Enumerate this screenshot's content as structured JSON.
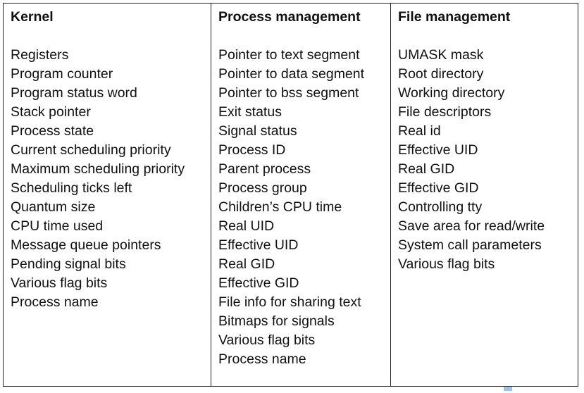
{
  "columns": [
    {
      "header": "Kernel",
      "items": [
        "Registers",
        "Program counter",
        "Program status word",
        "Stack pointer",
        "Process state",
        "Current scheduling priority",
        "Maximum scheduling priority",
        "Scheduling ticks left",
        "Quantum size",
        "CPU time used",
        "Message queue pointers",
        "Pending signal bits",
        "Various flag bits",
        "Process name"
      ]
    },
    {
      "header": "Process management",
      "items": [
        "Pointer to text segment",
        "Pointer to data segment",
        "Pointer to bss segment",
        "Exit status",
        "Signal status",
        "Process ID",
        "Parent process",
        "Process group",
        "Children’s CPU time",
        "Real UID",
        "Effective UID",
        "Real GID",
        "Effective GID",
        "File info for sharing text",
        "Bitmaps for signals",
        "Various flag bits",
        "Process name"
      ]
    },
    {
      "header": "File management",
      "items": [
        "UMASK mask",
        "Root directory",
        "Working directory",
        "File descriptors",
        "Real id",
        "Effective UID",
        "Real GID",
        "Effective GID",
        "Controlling tty",
        "Save area for read/write",
        "System call parameters",
        "Various flag bits"
      ]
    }
  ],
  "colors": {
    "text": "#111111",
    "border": "#222222",
    "corner_mark": "#9fc3e6"
  }
}
